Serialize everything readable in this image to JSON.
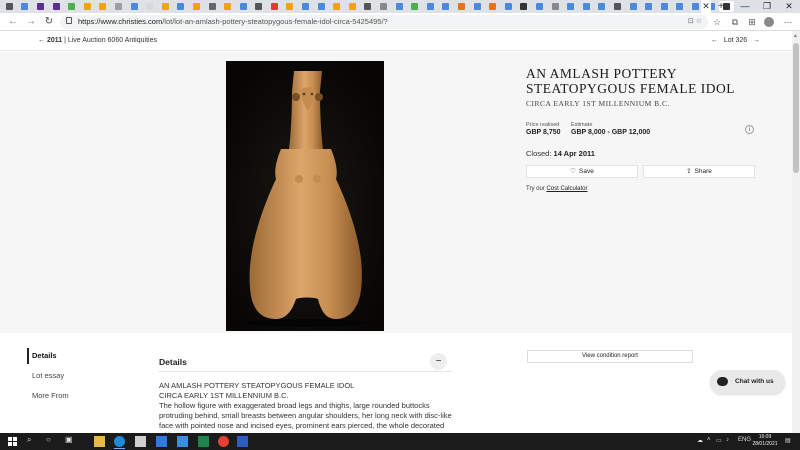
{
  "browser": {
    "tabs": [
      {
        "color": "#555555"
      },
      {
        "color": "#4a89dc"
      },
      {
        "color": "#5b2d90"
      },
      {
        "color": "#5b2d90"
      },
      {
        "color": "#4caf50"
      },
      {
        "color": "#f0a30a"
      },
      {
        "color": "#f0a30a"
      },
      {
        "color": "#9e9e9e"
      },
      {
        "color": "#4a89dc"
      },
      {
        "color": "#d9d9d9"
      },
      {
        "color": "#f0a30a"
      },
      {
        "color": "#4a89dc"
      },
      {
        "color": "#f0a30a"
      },
      {
        "color": "#666666"
      },
      {
        "color": "#f0a30a"
      },
      {
        "color": "#4a89dc"
      },
      {
        "color": "#555555"
      },
      {
        "color": "#e53935"
      },
      {
        "color": "#f0a30a"
      },
      {
        "color": "#4a89dc"
      },
      {
        "color": "#4a89dc"
      },
      {
        "color": "#f0a30a"
      },
      {
        "color": "#f0a30a"
      },
      {
        "color": "#555555"
      },
      {
        "color": "#888888"
      },
      {
        "color": "#4a89dc"
      },
      {
        "color": "#4caf50"
      },
      {
        "color": "#4a89dc"
      },
      {
        "color": "#4a89dc"
      },
      {
        "color": "#e8711c"
      },
      {
        "color": "#4a89dc"
      },
      {
        "color": "#e8711c"
      },
      {
        "color": "#4a89dc"
      },
      {
        "color": "#333333"
      },
      {
        "color": "#4a89dc"
      },
      {
        "color": "#888888"
      },
      {
        "color": "#4a89dc"
      },
      {
        "color": "#4a89dc"
      },
      {
        "color": "#4a89dc"
      },
      {
        "color": "#555555"
      },
      {
        "color": "#4a89dc"
      },
      {
        "color": "#4a89dc"
      },
      {
        "color": "#4a89dc"
      },
      {
        "color": "#4a89dc"
      },
      {
        "color": "#4a89dc"
      },
      {
        "color": "#4a89dc"
      },
      {
        "color": "#333333"
      }
    ],
    "url_host": "https://www.christies.com",
    "url_path": "/lot/lot-an-amlash-pottery-steatopygous-female-idol-circa-5425495/?"
  },
  "lotbar": {
    "back_year": "2011",
    "back_text": " | Live Auction 6060 Antiquities",
    "lot_label": "Lot 326"
  },
  "lot": {
    "title": "AN AMLASH POTTERY STEATOPYGOUS FEMALE IDOL",
    "subtitle": "CIRCA EARLY 1ST MILLENNIUM B.C.",
    "price_label": "Price realised",
    "price_value": "GBP 8,750",
    "estimate_label": "Estimate",
    "estimate_value": "GBP 8,000 - GBP 12,000",
    "closed_label": "Closed:",
    "closed_date": "14 Apr 2011",
    "save_label": "Save",
    "share_label": "Share",
    "cost_prefix": "Try our",
    "cost_link": "Cost Calculator"
  },
  "side_nav": [
    "Details",
    "Lot essay",
    "More From"
  ],
  "details": {
    "heading": "Details",
    "lines": [
      "AN AMLASH POTTERY STEATOPYGOUS FEMALE IDOL",
      "CIRCA EARLY 1ST MILLENNIUM B.C.",
      "The hollow figure with exaggerated broad legs and thighs, large rounded buttocks",
      "protruding behind, small breasts between angular shoulders, her long neck with disc-like",
      "face with pointed nose and incised eyes, prominent ears pierced, the whole decorated with"
    ]
  },
  "condition_label": "View condition report",
  "chat_label": "Chat with us",
  "taskbar": {
    "clock_time": "16:09",
    "clock_date": "28/01/2021",
    "lang": "ENG"
  }
}
